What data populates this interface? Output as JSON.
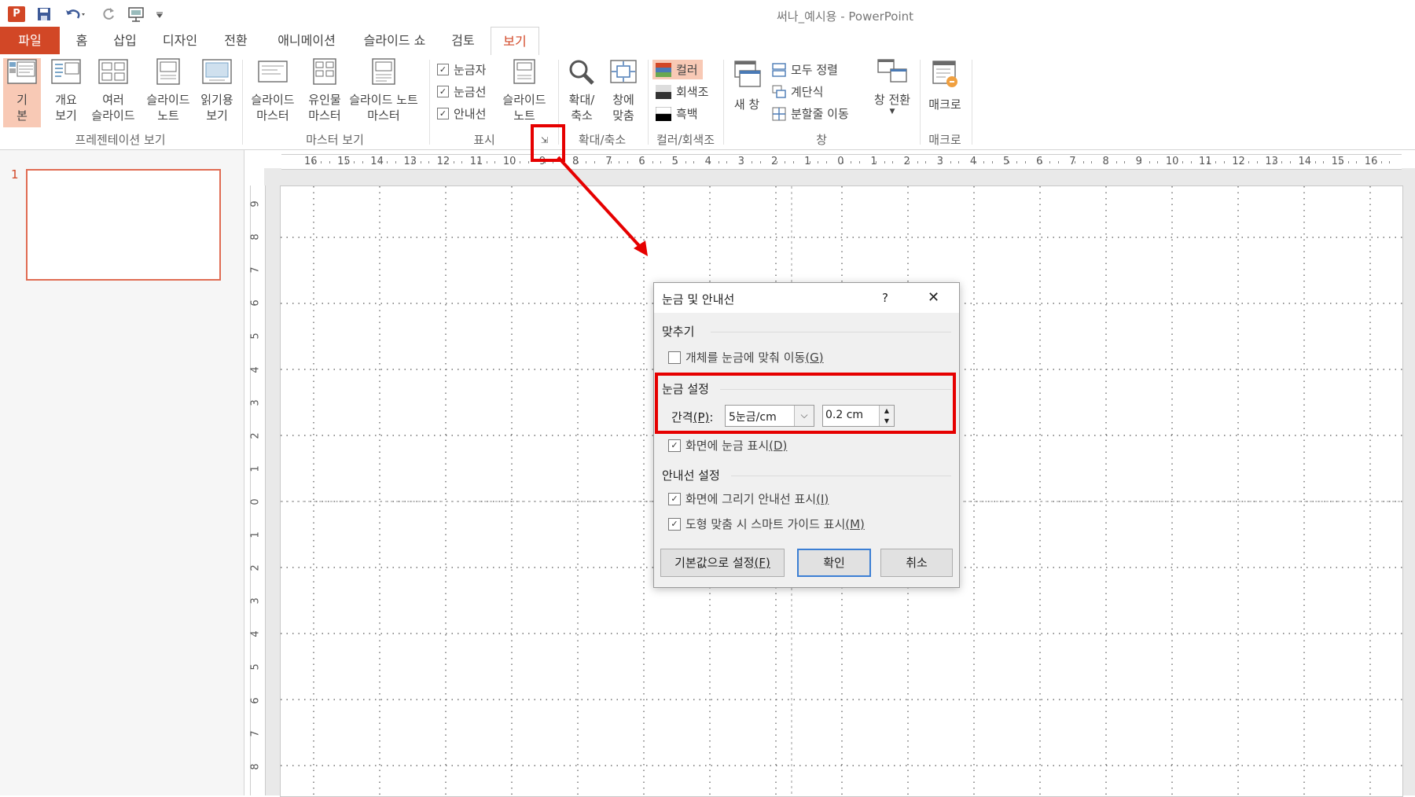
{
  "window": {
    "title": "써나_예시용 - PowerPoint"
  },
  "quick_access": {
    "icons": [
      "powerpoint-logo-icon",
      "save-icon",
      "undo-icon",
      "redo-icon",
      "presentation-start-icon",
      "customize-dropdown-icon"
    ],
    "logo_letter": "P"
  },
  "tabs": [
    {
      "label": "파일"
    },
    {
      "label": "홈"
    },
    {
      "label": "삽입"
    },
    {
      "label": "디자인"
    },
    {
      "label": "전환"
    },
    {
      "label": "애니메이션"
    },
    {
      "label": "슬라이드 쇼"
    },
    {
      "label": "검토"
    },
    {
      "label": "보기"
    }
  ],
  "ribbon": {
    "presentation_views": {
      "group_label": "프레젠테이션 보기",
      "buttons": [
        {
          "line1": "기",
          "line2": "본"
        },
        {
          "line1": "개요",
          "line2": "보기"
        },
        {
          "line1": "여러",
          "line2": "슬라이드"
        },
        {
          "line1": "슬라이드",
          "line2": "노트"
        },
        {
          "line1": "읽기용",
          "line2": "보기"
        }
      ]
    },
    "master_views": {
      "group_label": "마스터 보기",
      "buttons": [
        {
          "line1": "슬라이드",
          "line2": "마스터"
        },
        {
          "line1": "유인물",
          "line2": "마스터"
        },
        {
          "line1": "슬라이드 노트",
          "line2": "마스터"
        }
      ]
    },
    "show": {
      "group_label": "표시",
      "checkboxes": [
        {
          "label": "눈금자",
          "checked": true
        },
        {
          "label": "눈금선",
          "checked": true
        },
        {
          "label": "안내선",
          "checked": true
        }
      ],
      "notes": {
        "line1": "슬라이드",
        "line2": "노트"
      },
      "launcher_glyph": "⇲"
    },
    "zoom": {
      "group_label": "확대/축소",
      "buttons": [
        {
          "line1": "확대/",
          "line2": "축소"
        },
        {
          "line1": "창에",
          "line2": "맞춤"
        }
      ]
    },
    "color": {
      "group_label": "컬러/회색조",
      "items": [
        {
          "label": "컬러"
        },
        {
          "label": "회색조"
        },
        {
          "label": "흑백"
        }
      ]
    },
    "window": {
      "group_label": "창",
      "new_window": "새 창",
      "items": [
        {
          "label": "모두 정렬"
        },
        {
          "label": "계단식"
        },
        {
          "label": "분할줄 이동"
        }
      ],
      "switch": "창 전환"
    },
    "macro": {
      "group_label": "매크로",
      "button": "매크로"
    }
  },
  "slides_pane": {
    "slide_number": "1"
  },
  "rulers": {
    "horizontal": [
      "16",
      "15",
      "14",
      "13",
      "12",
      "11",
      "10",
      "9",
      "8",
      "7",
      "6",
      "5",
      "4",
      "3",
      "2",
      "1",
      "0",
      "1",
      "2",
      "3",
      "4",
      "5",
      "6",
      "7",
      "8",
      "9",
      "10",
      "11",
      "12",
      "13",
      "14",
      "15",
      "16"
    ],
    "vertical": [
      "9",
      "8",
      "7",
      "6",
      "5",
      "4",
      "3",
      "2",
      "1",
      "0",
      "1",
      "2",
      "3",
      "4",
      "5",
      "6",
      "7",
      "8"
    ]
  },
  "dialog": {
    "title": "눈금 및 안내선",
    "help": "?",
    "close": "✕",
    "snap": {
      "header": "맞추기",
      "option": {
        "label": "개체를 눈금에 맞춰 이동",
        "key": "(G)",
        "checked": false
      }
    },
    "grid": {
      "header": "눈금 설정",
      "spacing_label": "간격",
      "spacing_key": "(P)",
      "spacing_colon": ":",
      "spacing_select": "5눈금/cm",
      "spacing_value": "0.2 cm",
      "show_option": {
        "label": "화면에 눈금 표시",
        "key": "(D)",
        "checked": true
      }
    },
    "guides": {
      "header": "안내선 설정",
      "options": [
        {
          "label": "화면에 그리기 안내선 표시",
          "key": "(I)",
          "checked": true
        },
        {
          "label": "도형 맞춤 시 스마트 가이드 표시",
          "key": "(M)",
          "checked": true
        }
      ]
    },
    "buttons": {
      "default": "기본값으로 설정",
      "default_key": "(F)",
      "ok": "확인",
      "cancel": "취소"
    }
  },
  "colors": {
    "accent": "#d24726",
    "highlight": "#e60000",
    "selected_view": "#f8c9b5",
    "grid_dot": "#555555"
  }
}
